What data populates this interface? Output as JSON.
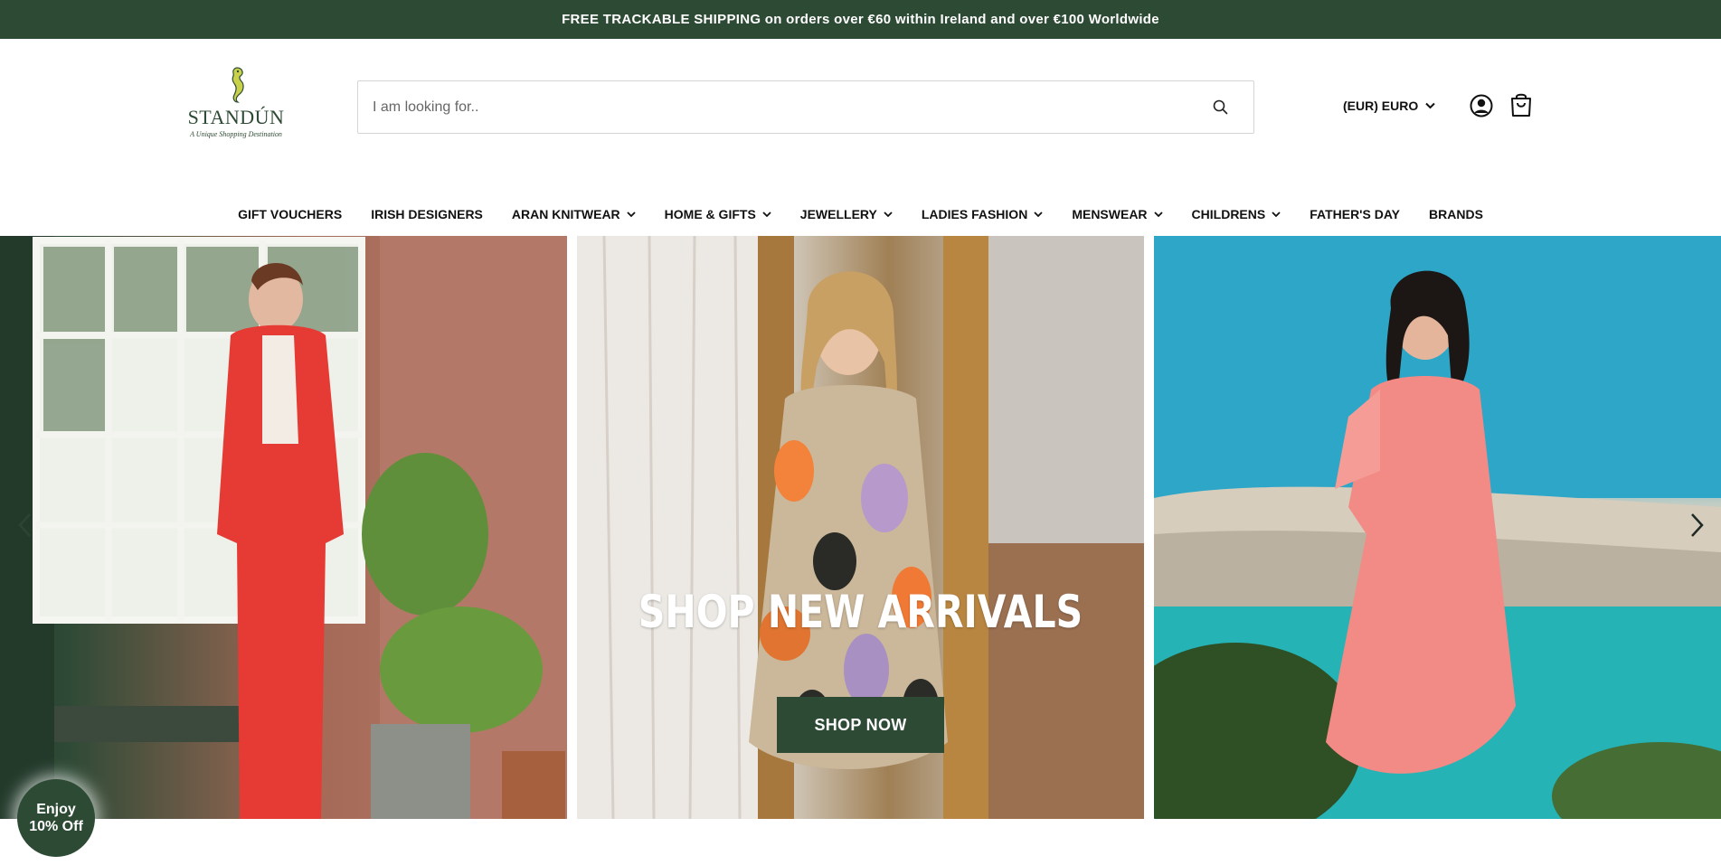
{
  "announcement": {
    "text": "FREE TRACKABLE SHIPPING on orders over €60 within Ireland and over €100 Worldwide"
  },
  "logo": {
    "name": "STANDÚN",
    "tagline": "A Unique Shopping Destination"
  },
  "search": {
    "placeholder": "I am looking for..",
    "value": "",
    "icon": "search-icon"
  },
  "currency": {
    "label": "(EUR) EURO"
  },
  "header_icons": [
    "user-icon",
    "bag-icon"
  ],
  "nav": {
    "items": [
      {
        "label": "GIFT VOUCHERS",
        "dropdown": false
      },
      {
        "label": "IRISH DESIGNERS",
        "dropdown": false
      },
      {
        "label": "ARAN KNITWEAR",
        "dropdown": true
      },
      {
        "label": "HOME & GIFTS",
        "dropdown": true
      },
      {
        "label": "JEWELLERY",
        "dropdown": true
      },
      {
        "label": "LADIES FASHION",
        "dropdown": true
      },
      {
        "label": "MENSWEAR",
        "dropdown": true
      },
      {
        "label": "CHILDRENS",
        "dropdown": true
      },
      {
        "label": "FATHER'S DAY",
        "dropdown": false
      },
      {
        "label": "BRANDS",
        "dropdown": false
      }
    ]
  },
  "hero": {
    "title": "SHOP NEW ARRIVALS",
    "button_label": "SHOP NOW"
  },
  "promo": {
    "line1": "Enjoy",
    "line2": "10% Off"
  },
  "colors": {
    "brand_green": "#2c4a34",
    "accent_logo": "#c9d14a"
  }
}
